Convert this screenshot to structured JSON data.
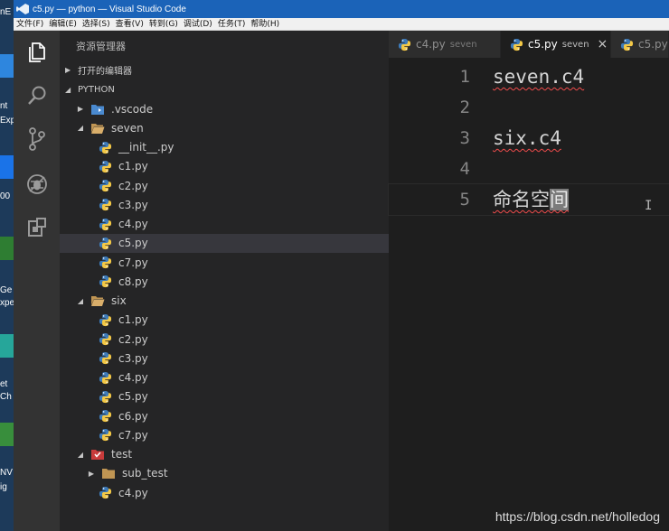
{
  "window": {
    "title": "c5.py — python — Visual Studio Code"
  },
  "desktop": {
    "fragments": [
      "nE",
      "nt",
      "Exp",
      "00",
      "Ge",
      "xpe",
      "et",
      "Ch",
      "NV",
      "ig"
    ]
  },
  "menu": [
    "文件(F)",
    "编辑(E)",
    "选择(S)",
    "查看(V)",
    "转到(G)",
    "调试(D)",
    "任务(T)",
    "帮助(H)"
  ],
  "activity": {
    "items": [
      {
        "name": "explorer",
        "icon": "files-icon",
        "active": true
      },
      {
        "name": "search",
        "icon": "search-icon",
        "active": false
      },
      {
        "name": "source-control",
        "icon": "git-branch-icon",
        "active": false
      },
      {
        "name": "debug",
        "icon": "bug-icon",
        "active": false
      },
      {
        "name": "extensions",
        "icon": "extensions-icon",
        "active": false
      }
    ]
  },
  "sidebar": {
    "title": "资源管理器",
    "open_editors": "打开的编辑器",
    "workspace": "PYTHON",
    "tree": [
      {
        "label": ".vscode",
        "type": "folder-vscode",
        "depth": 1,
        "twisty": "collapsed"
      },
      {
        "label": "seven",
        "type": "folder-open",
        "depth": 1,
        "twisty": "expanded"
      },
      {
        "label": "__init__.py",
        "type": "python",
        "depth": 2
      },
      {
        "label": "c1.py",
        "type": "python",
        "depth": 2
      },
      {
        "label": "c2.py",
        "type": "python",
        "depth": 2
      },
      {
        "label": "c3.py",
        "type": "python",
        "depth": 2
      },
      {
        "label": "c4.py",
        "type": "python",
        "depth": 2
      },
      {
        "label": "c5.py",
        "type": "python",
        "depth": 2,
        "selected": true
      },
      {
        "label": "c7.py",
        "type": "python",
        "depth": 2
      },
      {
        "label": "c8.py",
        "type": "python",
        "depth": 2
      },
      {
        "label": "six",
        "type": "folder-open",
        "depth": 1,
        "twisty": "expanded"
      },
      {
        "label": "c1.py",
        "type": "python",
        "depth": 2
      },
      {
        "label": "c2.py",
        "type": "python",
        "depth": 2
      },
      {
        "label": "c3.py",
        "type": "python",
        "depth": 2
      },
      {
        "label": "c4.py",
        "type": "python",
        "depth": 2
      },
      {
        "label": "c5.py",
        "type": "python",
        "depth": 2
      },
      {
        "label": "c6.py",
        "type": "python",
        "depth": 2
      },
      {
        "label": "c7.py",
        "type": "python",
        "depth": 2
      },
      {
        "label": "test",
        "type": "folder-test",
        "depth": 1,
        "twisty": "expanded"
      },
      {
        "label": "sub_test",
        "type": "folder-closed",
        "depth": 2,
        "twisty": "collapsed"
      },
      {
        "label": "c4.py",
        "type": "python",
        "depth": 2
      }
    ]
  },
  "tabs": [
    {
      "name": "c4.py",
      "desc": "seven",
      "active": false
    },
    {
      "name": "c5.py",
      "desc": "seven",
      "active": true,
      "close": "×"
    },
    {
      "name": "c5.py",
      "desc": "",
      "active": false
    }
  ],
  "editor": {
    "lines": [
      {
        "number": "1",
        "text": "seven.c4",
        "squiggle": true
      },
      {
        "number": "2",
        "text": ""
      },
      {
        "number": "3",
        "text": "six.c4",
        "squiggle": true
      },
      {
        "number": "4",
        "text": ""
      },
      {
        "number": "5",
        "text": "命名空",
        "selected_text": "间",
        "squiggle": true,
        "current": true
      }
    ],
    "cursor": "I"
  },
  "watermark": "https://blog.csdn.net/holledog",
  "colors": {
    "titlebar": "#1b63b8",
    "activitybar": "#333333",
    "sidebar": "#252526",
    "editor": "#1e1e1e",
    "python_blue": "#3d7ab8",
    "python_yellow": "#f3c846"
  }
}
